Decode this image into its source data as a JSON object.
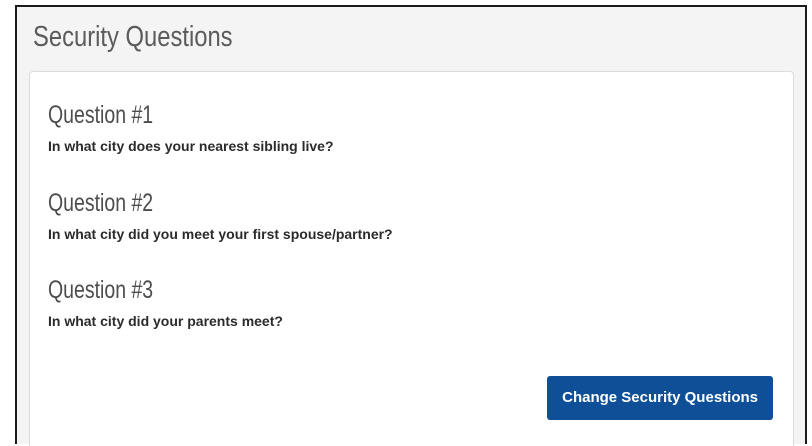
{
  "panel": {
    "title": "Security Questions"
  },
  "questions": [
    {
      "heading": "Question #1",
      "text": "In what city does your nearest sibling live?"
    },
    {
      "heading": "Question #2",
      "text": "In what city did you meet your first spouse/partner?"
    },
    {
      "heading": "Question #3",
      "text": "In what city did your parents meet?"
    }
  ],
  "actions": {
    "change_label": "Change Security Questions"
  },
  "colors": {
    "button_background": "#0f4f97",
    "panel_background": "#f4f4f4",
    "heading_text": "#4d4d4d"
  }
}
